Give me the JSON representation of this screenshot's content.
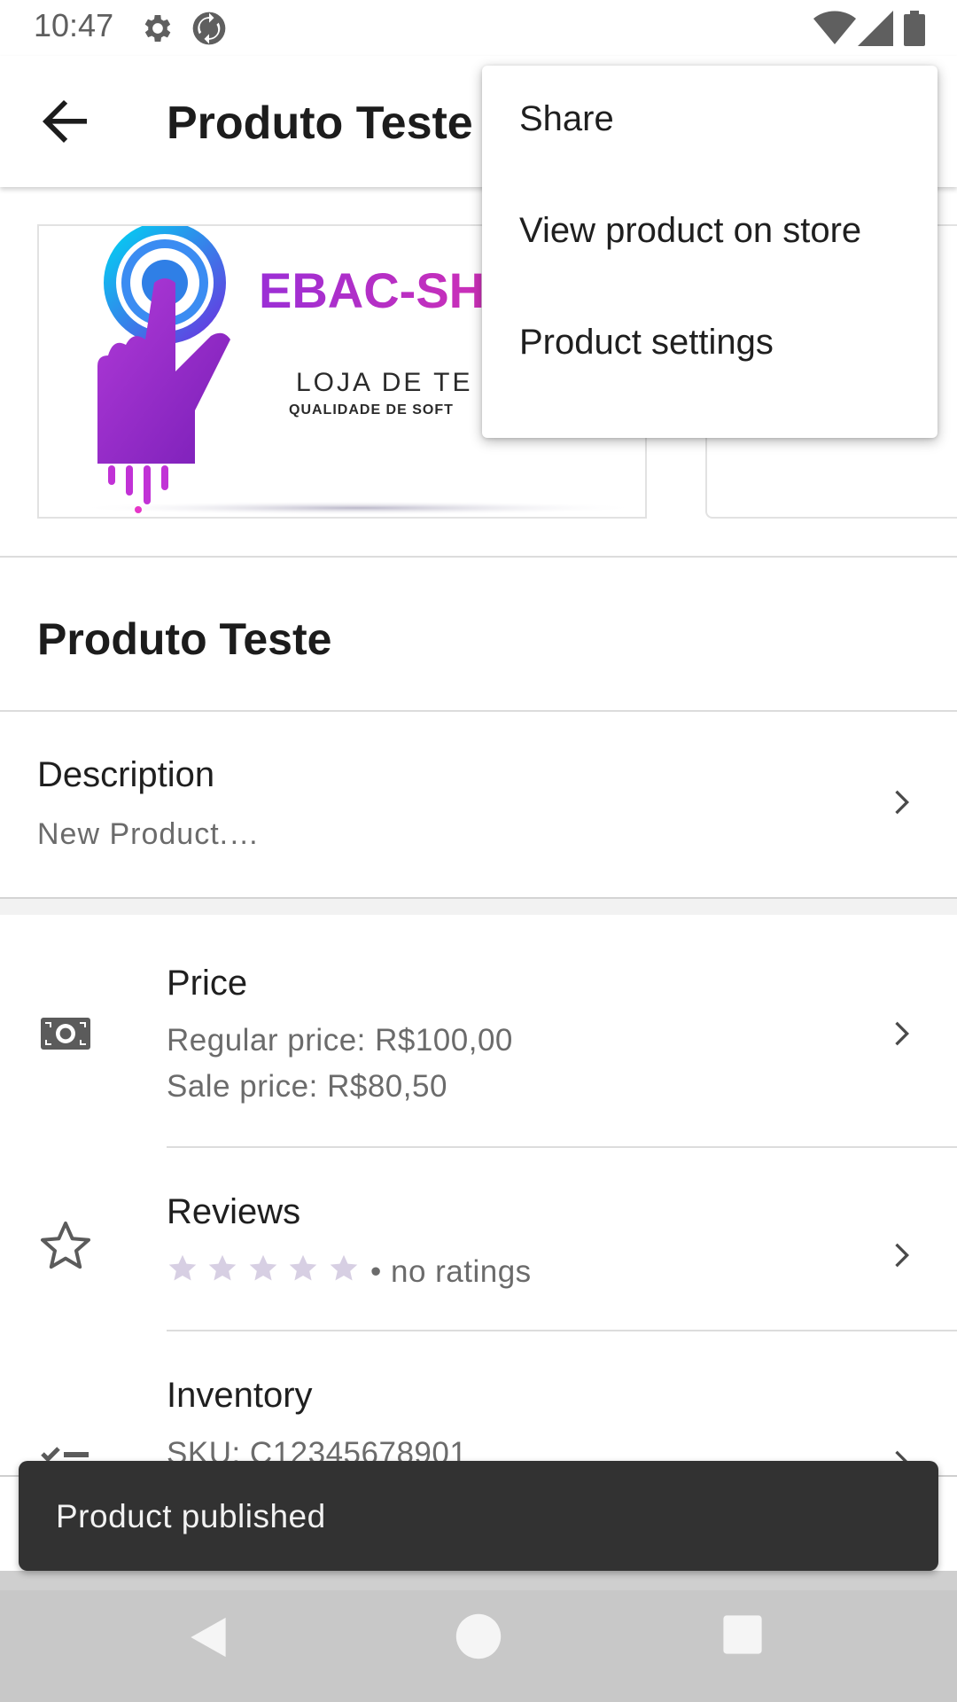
{
  "status_bar": {
    "time": "10:47",
    "icons": [
      "gear-icon",
      "sync-icon",
      "wifi-icon",
      "signal-icon",
      "battery-icon"
    ]
  },
  "app_bar": {
    "title": "Produto Teste",
    "back_icon": "arrow-back-icon"
  },
  "images": {
    "logo_text": "EBAC-SH",
    "logo_subtitle_1": "LOJA DE TE",
    "logo_subtitle_2": "QUALIDADE DE SOFT"
  },
  "product": {
    "name": "Produto Teste"
  },
  "description": {
    "label": "Description",
    "value": "New Product.…"
  },
  "price": {
    "label": "Price",
    "regular": "Regular price: R$100,00",
    "sale": "Sale price: R$80,50",
    "icon": "money-icon"
  },
  "reviews": {
    "label": "Reviews",
    "stars": 0,
    "max_stars": 5,
    "ratings_text": "• no ratings",
    "icon": "star-outline-icon",
    "star_color": "#d7cfe3"
  },
  "inventory": {
    "label": "Inventory",
    "sku": "SKU: C12345678901",
    "icon": "checklist-icon"
  },
  "menu": {
    "items": [
      "Share",
      "View product on store",
      "Product settings"
    ]
  },
  "snackbar": {
    "message": "Product published"
  },
  "nav_bar": {
    "icons": [
      "nav-back-icon",
      "nav-home-icon",
      "nav-recents-icon"
    ]
  }
}
